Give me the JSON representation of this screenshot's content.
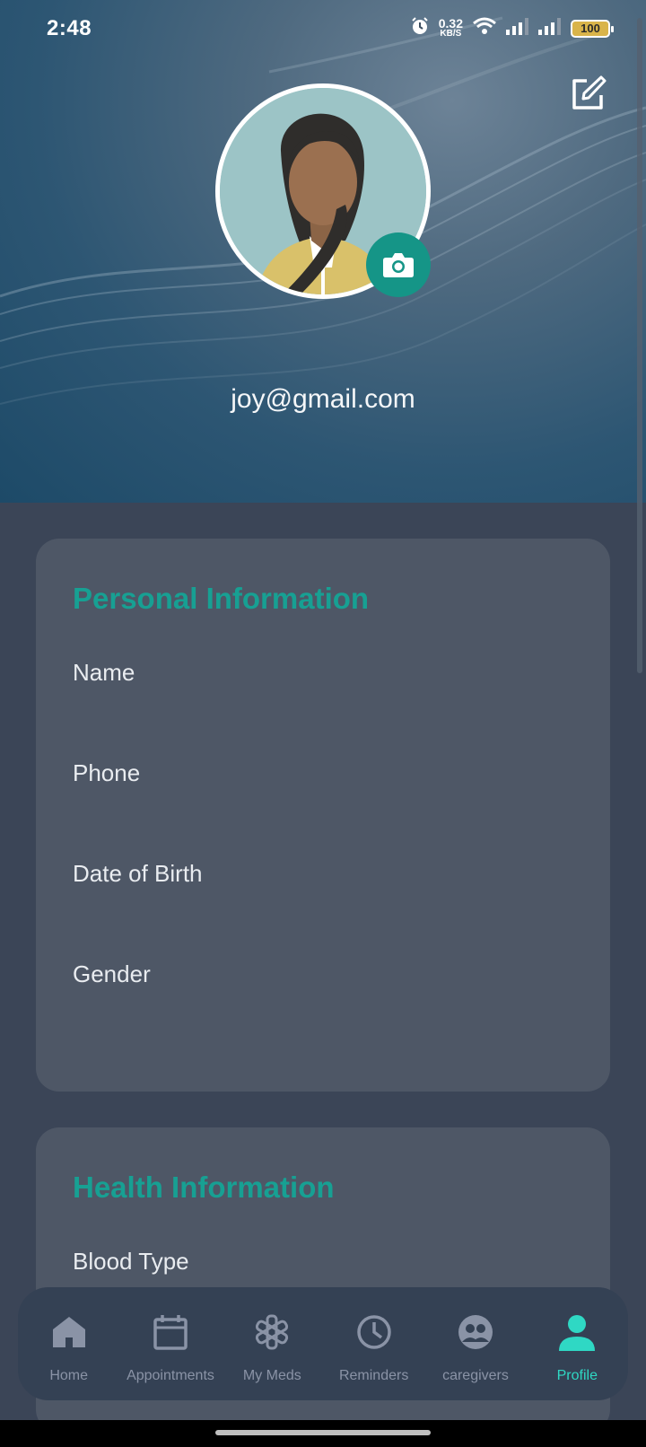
{
  "status_bar": {
    "time": "2:48",
    "net_speed_value": "0.32",
    "net_speed_unit": "KB/S",
    "battery": "100",
    "icons": [
      "alarm-icon",
      "wifi-icon",
      "signal-icon",
      "signal-icon",
      "battery-icon"
    ]
  },
  "header": {
    "email": "joy@gmail.com",
    "edit_icon": "edit-icon",
    "camera_icon": "camera-icon"
  },
  "cards": {
    "personal": {
      "title": "Personal Information",
      "fields": [
        "Name",
        "Phone",
        "Date of Birth",
        "Gender"
      ]
    },
    "health": {
      "title": "Health Information",
      "fields": [
        "Blood Type"
      ]
    }
  },
  "nav": {
    "items": [
      {
        "label": "Home",
        "icon": "home-icon"
      },
      {
        "label": "Appointments",
        "icon": "calendar-icon"
      },
      {
        "label": "My Meds",
        "icon": "medical-star-icon"
      },
      {
        "label": "Reminders",
        "icon": "clock-icon"
      },
      {
        "label": "caregivers",
        "icon": "group-icon"
      },
      {
        "label": "Profile",
        "icon": "person-icon"
      }
    ],
    "active": "Profile"
  },
  "colors": {
    "accent": "#17a093",
    "active_nav": "#2fd8c4",
    "camera_button": "#159587",
    "card_bg": "#4e5766",
    "page_bg": "#3b4557",
    "nav_bg": "#344154"
  }
}
